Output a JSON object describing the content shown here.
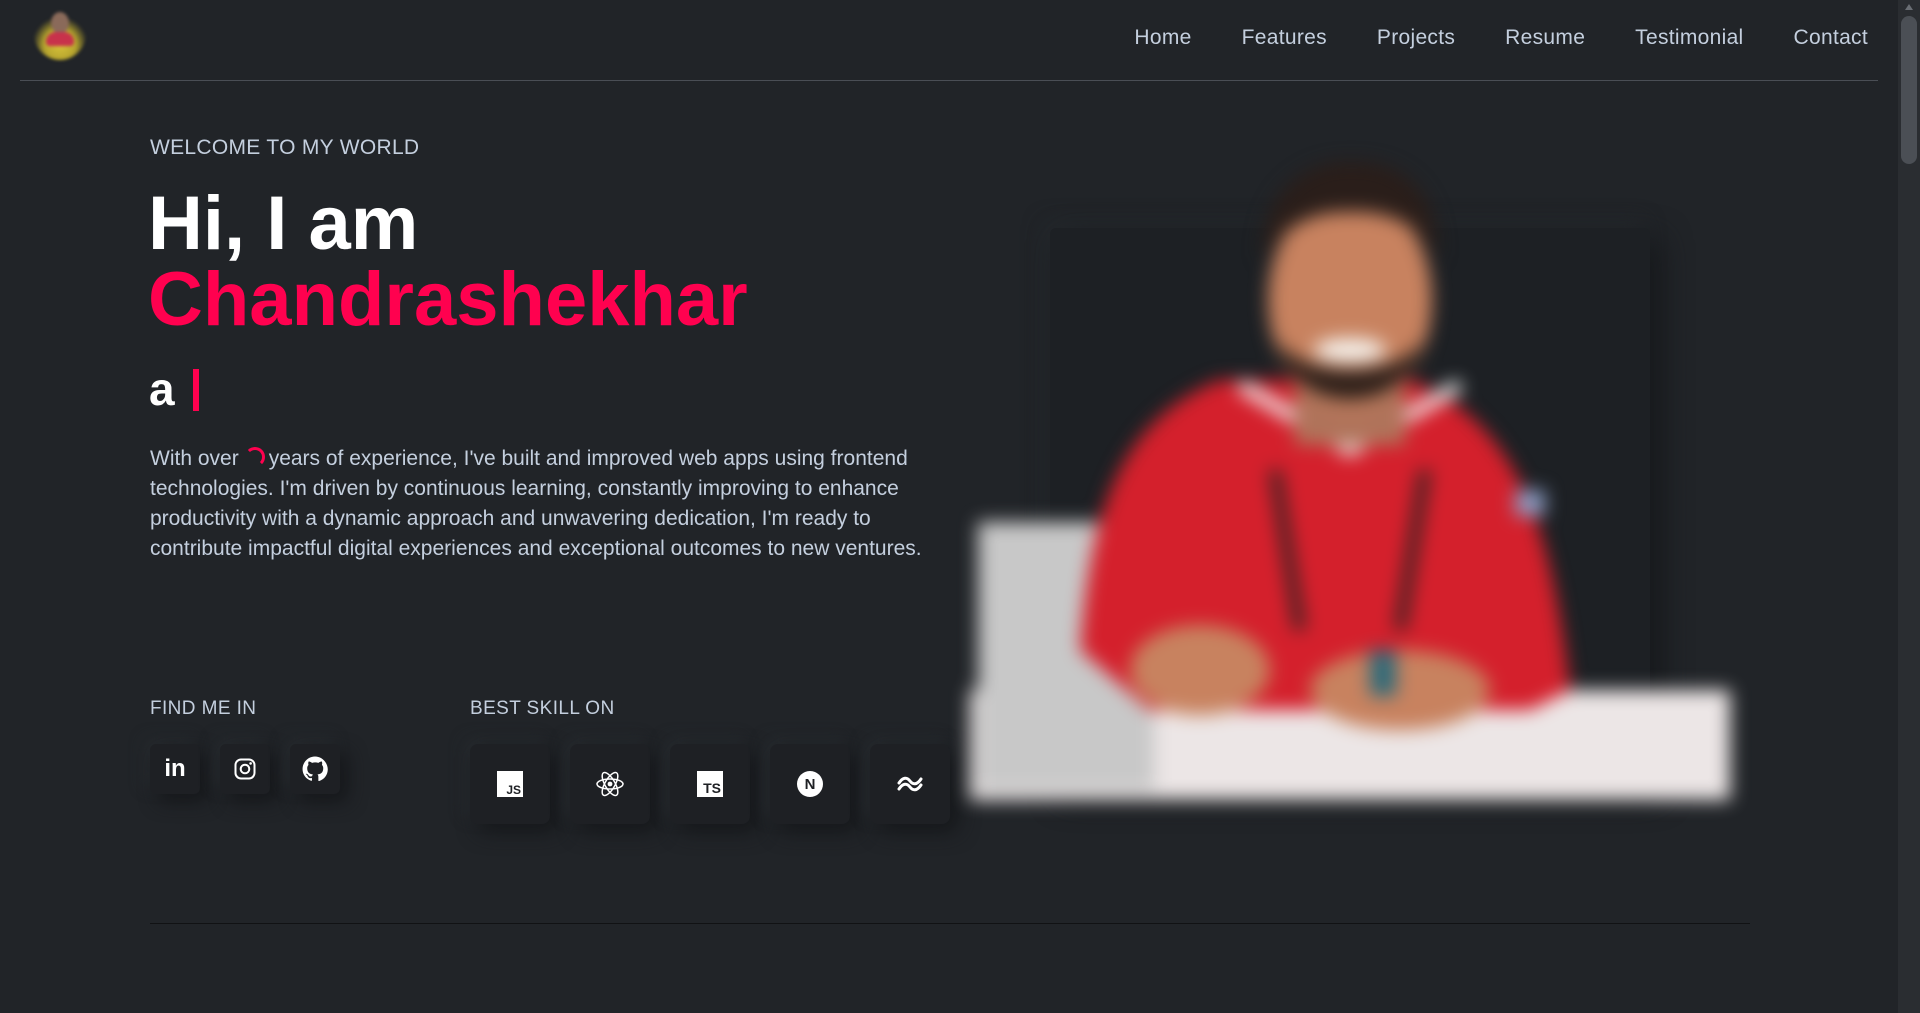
{
  "header": {
    "logo_alt": "profile avatar",
    "nav": [
      "Home",
      "Features",
      "Projects",
      "Resume",
      "Testimonial",
      "Contact"
    ]
  },
  "hero": {
    "welcome": "WELCOME TO MY WORLD",
    "greeting": "Hi, I am",
    "name": "Chandrashekhar",
    "typed_prefix": "a",
    "desc_before": "With over",
    "desc_after": "years of experience, I've built and improved web apps using frontend technologies. I'm driven by continuous learning, constantly improving to enhance productivity with a dynamic approach and unwavering dedication, I'm ready to contribute impactful digital experiences and exceptional outcomes to new ventures."
  },
  "find_me": {
    "label": "FIND ME IN",
    "links": [
      {
        "icon": "linkedin-icon",
        "text": "in"
      },
      {
        "icon": "instagram-icon"
      },
      {
        "icon": "github-icon"
      }
    ]
  },
  "skills": {
    "label": "BEST SKILL ON",
    "items": [
      {
        "icon": "javascript-icon",
        "text": "JS"
      },
      {
        "icon": "react-icon"
      },
      {
        "icon": "typescript-icon",
        "text": "TS"
      },
      {
        "icon": "nextjs-icon",
        "text": "N"
      },
      {
        "icon": "tailwind-icon"
      }
    ]
  },
  "colors": {
    "background": "#212428",
    "accent": "#ff014f",
    "text": "#c4cfde",
    "heading": "#ffffff"
  }
}
